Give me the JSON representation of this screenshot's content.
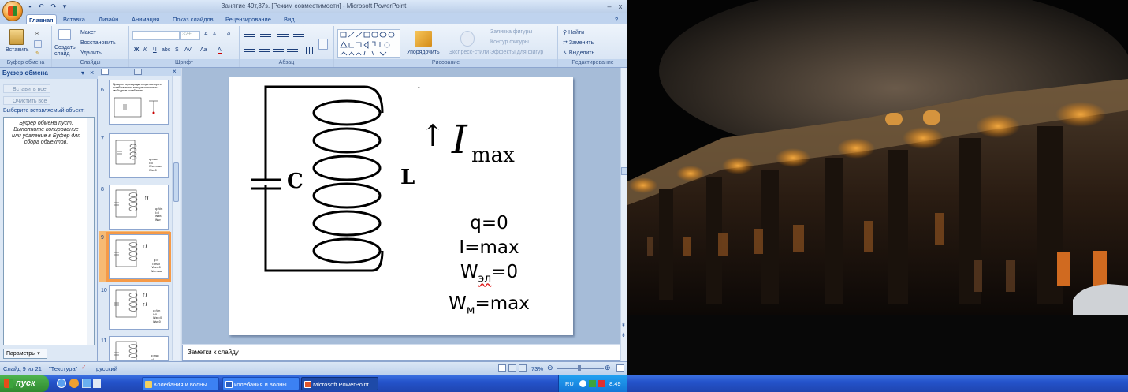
{
  "window": {
    "title": "Занятие 49т,37з. [Режим совместимости] - Microsoft PowerPoint",
    "minimize": "–",
    "close": "x"
  },
  "qat": {
    "save": "▪",
    "undo": "↶",
    "redo": "↷",
    "customize": "▾"
  },
  "tabs": [
    "Главная",
    "Вставка",
    "Дизайн",
    "Анимация",
    "Показ слайдов",
    "Рецензирование",
    "Вид"
  ],
  "ribbon": {
    "clipboard": {
      "paste": "Вставить",
      "group": "Буфер обмена"
    },
    "slides": {
      "new_slide": "Создать слайд",
      "layout": "Макет",
      "reset": "Восстановить",
      "delete": "Удалить",
      "group": "Слайды"
    },
    "font": {
      "size": "32+",
      "group": "Шрифт",
      "bold": "Ж",
      "italic": "К",
      "underline": "Ч",
      "strike": "abc",
      "shadow": "S",
      "spacing": "AV",
      "case": "Aa",
      "color": "A",
      "grow": "A",
      "shrink": "A"
    },
    "paragraph": {
      "group": "Абзац"
    },
    "drawing": {
      "arrange": "Упорядочить",
      "quick_styles": "Экспресс-стили",
      "fill": "Заливка фигуры",
      "outline": "Контур фигуры",
      "effects": "Эффекты для фигур",
      "group": "Рисование"
    },
    "editing": {
      "find": "Найти",
      "replace": "Заменить",
      "select": "Выделить",
      "group": "Редактирование"
    }
  },
  "clipboard_pane": {
    "title": "Буфер обмена",
    "paste_all": "Вставить все",
    "clear_all": "Очистить все",
    "prompt": "Выберите вставляемый объект:",
    "empty_message": "Буфер обмена пуст. Выполните копирование или удаление в Буфер для сбора объектов.",
    "options": "Параметры"
  },
  "thumbnails": [
    {
      "num": "6",
      "text": "Процесс перезарядки конденсатора в колебательном контуре относится к свободным колебаниям."
    },
    {
      "num": "7",
      "q": "q=max",
      "i": "I=0",
      "w1": "Wэл=max",
      "w2": "Wм=0"
    },
    {
      "num": "8",
      "q": "q=Vm",
      "i": "I=0",
      "w1": "Wэл↓",
      "w2": "Wм↑"
    },
    {
      "num": "9",
      "q": "q=0",
      "i": "I=max",
      "w1": "Wэл=0",
      "w2": "Wм=max"
    },
    {
      "num": "10",
      "q": "q=Vm",
      "i": "I=0",
      "w1": "Wэл=0",
      "w2": "Wм=0"
    },
    {
      "num": "11",
      "q": "q=max",
      "i": "I=0",
      "w1": "",
      "w2": ""
    }
  ],
  "slide": {
    "capacitor_label": "C",
    "inductor_label": "L",
    "current_symbol": "I",
    "current_sub": "max",
    "arrow": "↑",
    "dot": "-",
    "eq_q": "q=0",
    "eq_i": "I=max",
    "eq_wel_base": "W",
    "eq_wel_sub": "эл",
    "eq_wel_val": "=0",
    "eq_wm_base": "W",
    "eq_wm_sub": "м",
    "eq_wm_val": "=max"
  },
  "notes": {
    "placeholder": "Заметки к слайду"
  },
  "status": {
    "slide_info": "Слайд 9 из 21",
    "theme": "\"Текстура\"",
    "language": "русский",
    "zoom": "73%"
  },
  "taskbar": {
    "start": "пуск",
    "tasks": [
      "Колебания и волны",
      "колебания и волны ...",
      "Microsoft PowerPoint ..."
    ],
    "lang": "RU",
    "clock": "8:49"
  },
  "colors": {
    "accent": "#f59a48",
    "taskbar": "#2452c9",
    "ribbon": "#d5e2f3"
  }
}
